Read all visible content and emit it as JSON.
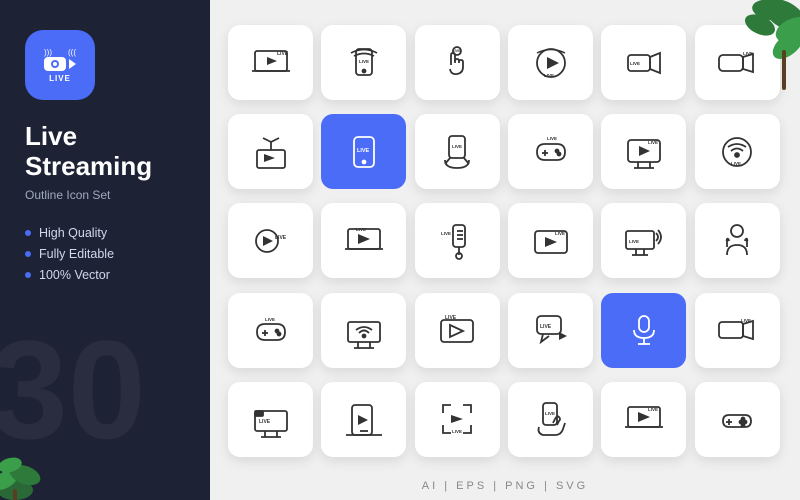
{
  "leftPanel": {
    "appIcon": {
      "liveLabel": "LIVE"
    },
    "title": "Live\nStreaming",
    "subtitle": "Outline Icon Set",
    "features": [
      "High Quality",
      "Fully Editable",
      "100% Vector"
    ],
    "bgNumber": "30"
  },
  "rightPanel": {
    "formatBar": "AI  |  EPS  |  PNG  |  SVG"
  }
}
